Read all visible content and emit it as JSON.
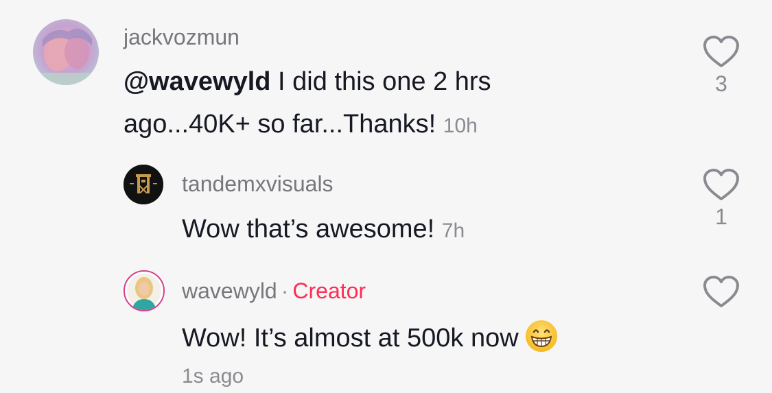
{
  "comments": [
    {
      "username": "jackvozmun",
      "mention": "@wavewyld",
      "text": " I did this one 2 hrs ago...40K+ so far...Thanks!",
      "time": "10h",
      "likes": "3"
    }
  ],
  "replies": [
    {
      "username": "tandemxvisuals",
      "text": "Wow that’s awesome!",
      "time": "7h",
      "likes": "1"
    },
    {
      "username": "wavewyld",
      "separator": "·",
      "badge": "Creator",
      "text": "Wow! It’s almost at 500k now",
      "emoji": "grinning-face-emoji",
      "time": "1s ago",
      "likes": ""
    }
  ],
  "colors": {
    "background": "#f6f6f6",
    "creator_badge": "#fe2c55",
    "muted_text": "#8a8b91"
  }
}
